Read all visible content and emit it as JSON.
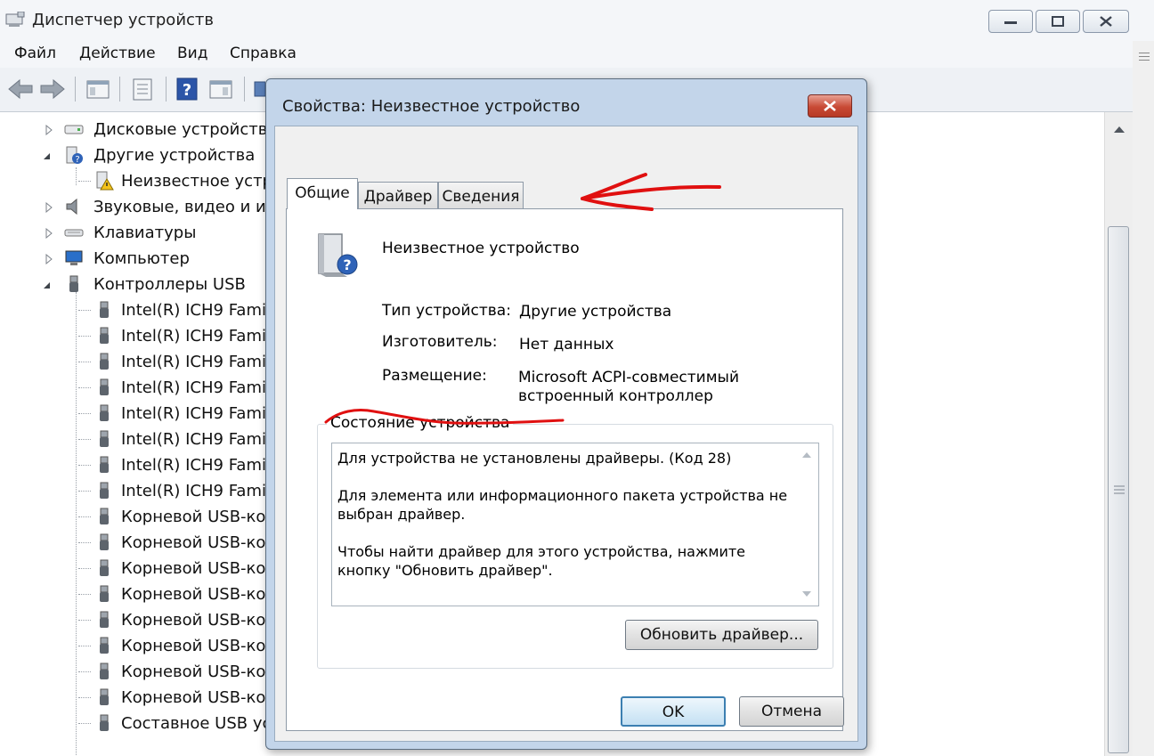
{
  "main_window": {
    "title": "Диспетчер устройств",
    "menu": [
      "Файл",
      "Действие",
      "Вид",
      "Справка"
    ]
  },
  "tree": {
    "items": [
      {
        "label": "Дисковые устройства",
        "icon": "disk-icon",
        "expander": "collapsed"
      },
      {
        "label": "Другие устройства",
        "icon": "unknown-device-icon",
        "expander": "expanded"
      },
      {
        "label": "Неизвестное устр",
        "icon": "warning-device-icon",
        "expander": "none",
        "child": true
      },
      {
        "label": "Звуковые, видео и игр",
        "icon": "speaker-icon",
        "expander": "collapsed"
      },
      {
        "label": "Клавиатуры",
        "icon": "keyboard-icon",
        "expander": "collapsed"
      },
      {
        "label": "Компьютер",
        "icon": "computer-icon",
        "expander": "collapsed"
      },
      {
        "label": "Контроллеры USB",
        "icon": "usb-icon",
        "expander": "expanded"
      },
      {
        "label": "Intel(R) ICH9 Famil",
        "icon": "usb-icon",
        "child": true
      },
      {
        "label": "Intel(R) ICH9 Famil",
        "icon": "usb-icon",
        "child": true
      },
      {
        "label": "Intel(R) ICH9 Famil",
        "icon": "usb-icon",
        "child": true
      },
      {
        "label": "Intel(R) ICH9 Famil",
        "icon": "usb-icon",
        "child": true
      },
      {
        "label": "Intel(R) ICH9 Famil",
        "icon": "usb-icon",
        "child": true
      },
      {
        "label": "Intel(R) ICH9 Famil",
        "icon": "usb-icon",
        "child": true
      },
      {
        "label": "Intel(R) ICH9 Famil",
        "icon": "usb-icon",
        "child": true
      },
      {
        "label": "Intel(R) ICH9 Famil",
        "icon": "usb-icon",
        "child": true
      },
      {
        "label": "Корневой USB-ко",
        "icon": "usb-icon",
        "child": true
      },
      {
        "label": "Корневой USB-ко",
        "icon": "usb-icon",
        "child": true
      },
      {
        "label": "Корневой USB-ко",
        "icon": "usb-icon",
        "child": true
      },
      {
        "label": "Корневой USB-ко",
        "icon": "usb-icon",
        "child": true
      },
      {
        "label": "Корневой USB-ко",
        "icon": "usb-icon",
        "child": true
      },
      {
        "label": "Корневой USB-ко",
        "icon": "usb-icon",
        "child": true
      },
      {
        "label": "Корневой USB-ко",
        "icon": "usb-icon",
        "child": true
      },
      {
        "label": "Корневой USB-ко",
        "icon": "usb-icon",
        "child": true
      },
      {
        "label": "Составное USB ус",
        "icon": "usb-icon",
        "child": true
      }
    ]
  },
  "dialog": {
    "title": "Свойства: Неизвестное устройство",
    "tabs": [
      "Общие",
      "Драйвер",
      "Сведения"
    ],
    "device_name": "Неизвестное устройство",
    "properties": [
      {
        "label": "Тип устройства:",
        "value": "Другие устройства"
      },
      {
        "label": "Изготовитель:",
        "value": "Нет данных"
      },
      {
        "label": "Размещение:",
        "value": "Microsoft ACPI-совместимый встроенный контроллер"
      }
    ],
    "status_group_label": "Состояние устройства",
    "status_paragraphs": [
      "Для устройства не установлены драйверы. (Код 28)",
      "Для элемента или информационного пакета устройства не выбран драйвер.",
      "Чтобы найти драйвер для этого устройства, нажмите кнопку \"Обновить драйвер\"."
    ],
    "update_button": "Обновить драйвер...",
    "ok_button": "OK",
    "cancel_button": "Отмена"
  },
  "annotation_color": "#e01010"
}
